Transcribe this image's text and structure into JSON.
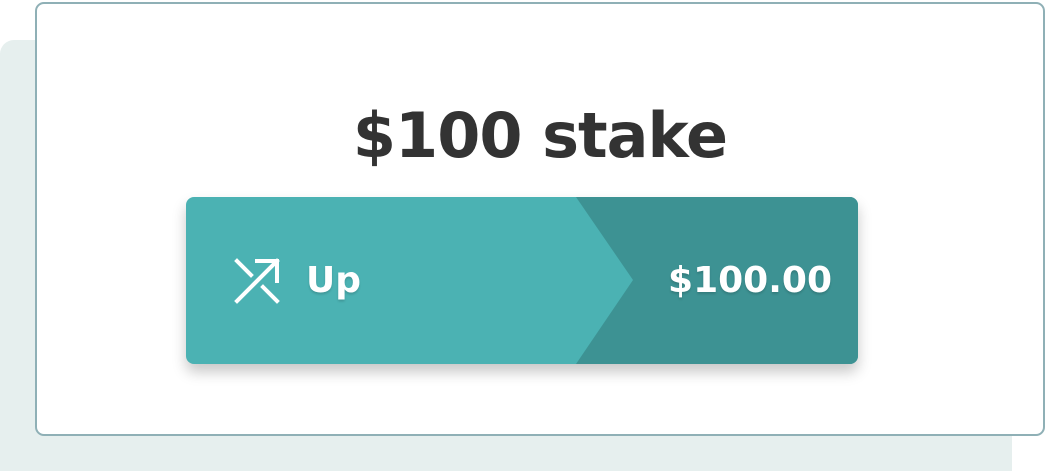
{
  "stake": {
    "title": "$100 stake"
  },
  "bet": {
    "direction_label": "Up",
    "amount": "$100.00",
    "direction_icon": "shuffle-arrows-icon",
    "colors": {
      "left": "#4bb2b3",
      "right": "#3d9293",
      "text": "#ffffff",
      "title": "#333333",
      "card_border": "#8fb0b6",
      "backdrop": "#e6efee"
    }
  }
}
